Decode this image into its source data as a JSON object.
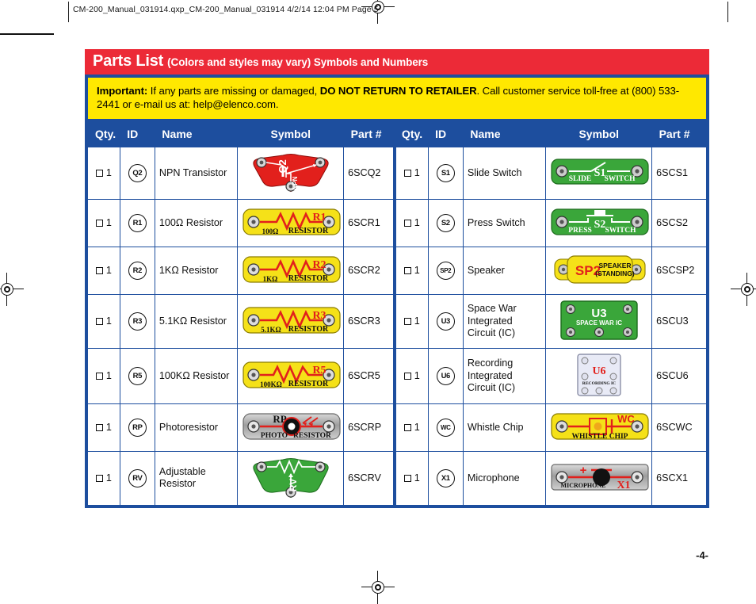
{
  "print_header": "CM-200_Manual_031914.qxp_CM-200_Manual_031914  4/2/14  12:04 PM  Page 5",
  "page_number": "-4-",
  "colors": {
    "title_bar": "#ec2a37",
    "table_header": "#1d4e9e",
    "important_bg": "#ffe800",
    "border": "#1d4e9e"
  },
  "title": {
    "main": "Parts List",
    "sub": "(Colors and styles may vary) Symbols and Numbers"
  },
  "important": {
    "label": "Important:",
    "text_1": " If any parts are missing or damaged, ",
    "emphasis": "DO NOT RETURN TO RETAILER",
    "text_2": ". Call customer service toll-free at (800) 533-2441 or e-mail us at:  help@elenco.com."
  },
  "table": {
    "headers": [
      "Qty.",
      "ID",
      "Name",
      "Symbol",
      "Part #",
      "Qty.",
      "ID",
      "Name",
      "Symbol",
      "Part #"
    ],
    "rows": [
      {
        "left": {
          "qty": "1",
          "id": "Q2",
          "name": "NPN Transistor",
          "symbol": "npn-transistor-symbol",
          "part": "6SCQ2"
        },
        "right": {
          "qty": "1",
          "id": "S1",
          "name": "Slide Switch",
          "symbol": "slide-switch-symbol",
          "part": "6SCS1"
        }
      },
      {
        "left": {
          "qty": "1",
          "id": "R1",
          "name": "100Ω Resistor",
          "symbol": "resistor-symbol",
          "part": "6SCR1"
        },
        "right": {
          "qty": "1",
          "id": "S2",
          "name": "Press Switch",
          "symbol": "press-switch-symbol",
          "part": "6SCS2"
        }
      },
      {
        "left": {
          "qty": "1",
          "id": "R2",
          "name": "1KΩ Resistor",
          "symbol": "resistor-symbol",
          "part": "6SCR2"
        },
        "right": {
          "qty": "1",
          "id": "SP2",
          "name": "Speaker",
          "symbol": "speaker-symbol",
          "part": "6SCSP2"
        }
      },
      {
        "left": {
          "qty": "1",
          "id": "R3",
          "name": "5.1KΩ Resistor",
          "symbol": "resistor-symbol",
          "part": "6SCR3"
        },
        "right": {
          "qty": "1",
          "id": "U3",
          "name": "Space War Integrated Circuit (IC)",
          "symbol": "space-war-ic-symbol",
          "part": "6SCU3"
        }
      },
      {
        "left": {
          "qty": "1",
          "id": "R5",
          "name": "100KΩ Resistor",
          "symbol": "resistor-symbol",
          "part": "6SCR5"
        },
        "right": {
          "qty": "1",
          "id": "U6",
          "name": "Recording Integrated Circuit (IC)",
          "symbol": "recording-ic-symbol",
          "part": "6SCU6"
        }
      },
      {
        "left": {
          "qty": "1",
          "id": "RP",
          "name": "Photoresistor",
          "symbol": "photoresistor-symbol",
          "part": "6SCRP"
        },
        "right": {
          "qty": "1",
          "id": "WC",
          "name": "Whistle Chip",
          "symbol": "whistle-chip-symbol",
          "part": "6SCWC"
        }
      },
      {
        "left": {
          "qty": "1",
          "id": "RV",
          "name": "Adjustable Resistor",
          "symbol": "adjustable-resistor-symbol",
          "part": "6SCRV"
        },
        "right": {
          "qty": "1",
          "id": "X1",
          "name": "Microphone",
          "symbol": "microphone-symbol",
          "part": "6SCX1"
        }
      }
    ]
  },
  "symbol_labels": {
    "npn": {
      "ref": "Q2",
      "text": "NPN"
    },
    "r1": {
      "ref": "R1",
      "value": "100Ω",
      "text": "RESISTOR"
    },
    "r2": {
      "ref": "R2",
      "value": "1KΩ",
      "text": "RESISTOR"
    },
    "r3": {
      "ref": "R3",
      "value": "5.1KΩ",
      "text": "RESISTOR"
    },
    "r5": {
      "ref": "R5",
      "value": "100KΩ",
      "text": "RESISTOR"
    },
    "rp": {
      "ref": "RP",
      "left": "PHOTO",
      "right": "RESISTOR"
    },
    "rv": {
      "ref": "RV"
    },
    "s1": {
      "ref": "S1",
      "left": "SLIDE",
      "right": "SWITCH"
    },
    "s2": {
      "ref": "S2",
      "left": "PRESS",
      "right": "SWITCH"
    },
    "sp2": {
      "ref": "SP2",
      "line1": "SPEAKER",
      "line2": "(STANDING)"
    },
    "u3": {
      "ref": "U3",
      "text": "SPACE WAR IC"
    },
    "u6": {
      "ref": "U6",
      "text": "RECORDING IC"
    },
    "wc": {
      "ref": "WC",
      "text": "WHISTLE CHIP"
    },
    "x1": {
      "ref": "X1",
      "text": "MICROPHONE",
      "plus": "+"
    }
  }
}
